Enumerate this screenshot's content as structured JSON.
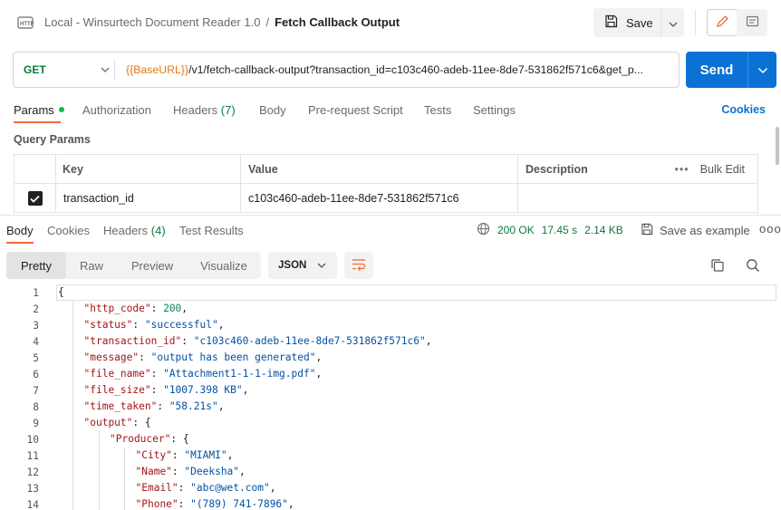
{
  "header": {
    "breadcrumb_parent": "Local - Winsurtech Document Reader 1.0",
    "breadcrumb_separator": "/",
    "breadcrumb_current": "Fetch Callback Output",
    "save_label": "Save"
  },
  "request": {
    "method": "GET",
    "url_variable": "{{BaseURL}}",
    "url_rest": "/v1/fetch-callback-output?transaction_id=c103c460-adeb-11ee-8de7-531862f571c6&get_p...",
    "send_label": "Send"
  },
  "request_tabs": [
    {
      "label": "Params",
      "count": ""
    },
    {
      "label": "Authorization",
      "count": ""
    },
    {
      "label": "Headers",
      "count": "(7)"
    },
    {
      "label": "Body",
      "count": ""
    },
    {
      "label": "Pre-request Script",
      "count": ""
    },
    {
      "label": "Tests",
      "count": ""
    },
    {
      "label": "Settings",
      "count": ""
    }
  ],
  "cookies_label": "Cookies",
  "query_params": {
    "title": "Query Params",
    "headers": {
      "key": "Key",
      "value": "Value",
      "description": "Description",
      "bulk_edit": "Bulk Edit"
    },
    "rows": [
      {
        "checked": true,
        "key": "transaction_id",
        "value": "c103c460-adeb-11ee-8de7-531862f571c6",
        "description": ""
      }
    ]
  },
  "response_tabs": [
    {
      "label": "Body",
      "count": ""
    },
    {
      "label": "Cookies",
      "count": ""
    },
    {
      "label": "Headers",
      "count": "(4)"
    },
    {
      "label": "Test Results",
      "count": ""
    }
  ],
  "response_meta": {
    "status": "200 OK",
    "time": "17.45 s",
    "size": "2.14 KB",
    "save_example_label": "Save as example",
    "more": "ooo"
  },
  "view_modes": [
    "Pretty",
    "Raw",
    "Preview",
    "Visualize"
  ],
  "format": "JSON",
  "code_lines": [
    {
      "n": "1",
      "indent": 0,
      "tokens": [
        [
          "p",
          "{"
        ]
      ]
    },
    {
      "n": "2",
      "indent": 1,
      "tokens": [
        [
          "k",
          "\"http_code\""
        ],
        [
          "p",
          ": "
        ],
        [
          "n",
          "200"
        ],
        [
          "p",
          ","
        ]
      ]
    },
    {
      "n": "3",
      "indent": 1,
      "tokens": [
        [
          "k",
          "\"status\""
        ],
        [
          "p",
          ": "
        ],
        [
          "s",
          "\"successful\""
        ],
        [
          "p",
          ","
        ]
      ]
    },
    {
      "n": "4",
      "indent": 1,
      "tokens": [
        [
          "k",
          "\"transaction_id\""
        ],
        [
          "p",
          ": "
        ],
        [
          "s",
          "\"c103c460-adeb-11ee-8de7-531862f571c6\""
        ],
        [
          "p",
          ","
        ]
      ]
    },
    {
      "n": "5",
      "indent": 1,
      "tokens": [
        [
          "k",
          "\"message\""
        ],
        [
          "p",
          ": "
        ],
        [
          "s",
          "\"output has been generated\""
        ],
        [
          "p",
          ","
        ]
      ]
    },
    {
      "n": "6",
      "indent": 1,
      "tokens": [
        [
          "k",
          "\"file_name\""
        ],
        [
          "p",
          ": "
        ],
        [
          "s",
          "\"Attachment1-1-1-img.pdf\""
        ],
        [
          "p",
          ","
        ]
      ]
    },
    {
      "n": "7",
      "indent": 1,
      "tokens": [
        [
          "k",
          "\"file_size\""
        ],
        [
          "p",
          ": "
        ],
        [
          "s",
          "\"1007.398 KB\""
        ],
        [
          "p",
          ","
        ]
      ]
    },
    {
      "n": "8",
      "indent": 1,
      "tokens": [
        [
          "k",
          "\"time_taken\""
        ],
        [
          "p",
          ": "
        ],
        [
          "s",
          "\"58.21s\""
        ],
        [
          "p",
          ","
        ]
      ]
    },
    {
      "n": "9",
      "indent": 1,
      "tokens": [
        [
          "k",
          "\"output\""
        ],
        [
          "p",
          ": {"
        ]
      ]
    },
    {
      "n": "10",
      "indent": 2,
      "tokens": [
        [
          "k",
          "\"Producer\""
        ],
        [
          "p",
          ": {"
        ]
      ]
    },
    {
      "n": "11",
      "indent": 3,
      "tokens": [
        [
          "k",
          "\"City\""
        ],
        [
          "p",
          ": "
        ],
        [
          "s",
          "\"MIAMI\""
        ],
        [
          "p",
          ","
        ]
      ]
    },
    {
      "n": "12",
      "indent": 3,
      "tokens": [
        [
          "k",
          "\"Name\""
        ],
        [
          "p",
          ": "
        ],
        [
          "s",
          "\"Deeksha\""
        ],
        [
          "p",
          ","
        ]
      ]
    },
    {
      "n": "13",
      "indent": 3,
      "tokens": [
        [
          "k",
          "\"Email\""
        ],
        [
          "p",
          ": "
        ],
        [
          "s",
          "\"abc@wet.com\""
        ],
        [
          "p",
          ","
        ]
      ]
    },
    {
      "n": "14",
      "indent": 3,
      "tokens": [
        [
          "k",
          "\"Phone\""
        ],
        [
          "p",
          ": "
        ],
        [
          "s",
          "\"(789) 741-7896\""
        ],
        [
          "p",
          ","
        ]
      ]
    }
  ],
  "colors": {
    "accent_orange": "#f26b3a",
    "send_blue": "#0a72d4",
    "method_green": "#0a7a3d",
    "variable_orange": "#e6770b",
    "json_key": "#a31515",
    "json_string": "#0451a5",
    "json_number": "#098658"
  },
  "icons": [
    "http-icon",
    "save-icon",
    "chevron-down-icon",
    "pencil-icon",
    "comment-icon",
    "globe-icon",
    "copy-icon",
    "search-icon",
    "wrap-icon",
    "checkbox-icon"
  ]
}
